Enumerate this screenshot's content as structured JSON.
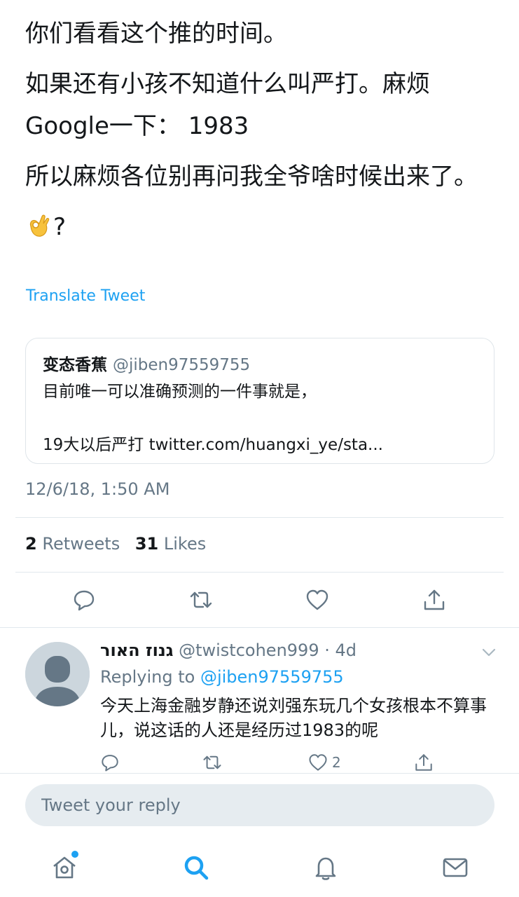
{
  "tweet": {
    "paragraphs": [
      "你们看看这个推的时间。",
      "如果还有小孩不知道什么叫严打。麻烦Google一下： 1983",
      "所以麻烦各位别再问我全爷啥时候出来了。"
    ],
    "last_line_suffix": "?",
    "translate_label": "Translate Tweet",
    "timestamp": "12/6/18, 1:50 AM"
  },
  "quoted": {
    "name": "变态香蕉",
    "handle": "@jiben97559755",
    "line1": "目前唯一可以准确预测的一件事就是，",
    "line2": "19大以后严打 twitter.com/huangxi_ye/sta..."
  },
  "stats": {
    "retweets_count": "2",
    "retweets_label": "Retweets",
    "likes_count": "31",
    "likes_label": "Likes"
  },
  "reply": {
    "name": "גנוז האור",
    "handle_time": "@twistcohen999 · 4d",
    "replying_prefix": "Replying to",
    "replying_to": "@jiben97559755",
    "text": "今天上海金融岁静还说刘强东玩几个女孩根本不算事儿，说这话的人还是经历过1983的呢",
    "like_count": "2"
  },
  "composer": {
    "placeholder": "Tweet your reply"
  },
  "icons": {
    "reply": "reply-icon",
    "retweet": "retweet-icon",
    "like": "heart-icon",
    "share": "share-icon",
    "home": "home-icon",
    "search": "search-icon",
    "notifications": "bell-icon",
    "messages": "envelope-icon"
  },
  "colors": {
    "accent": "#1da1f2",
    "secondary_text": "#657786",
    "icon_gray": "#657786",
    "divider": "#e1e8ed"
  }
}
